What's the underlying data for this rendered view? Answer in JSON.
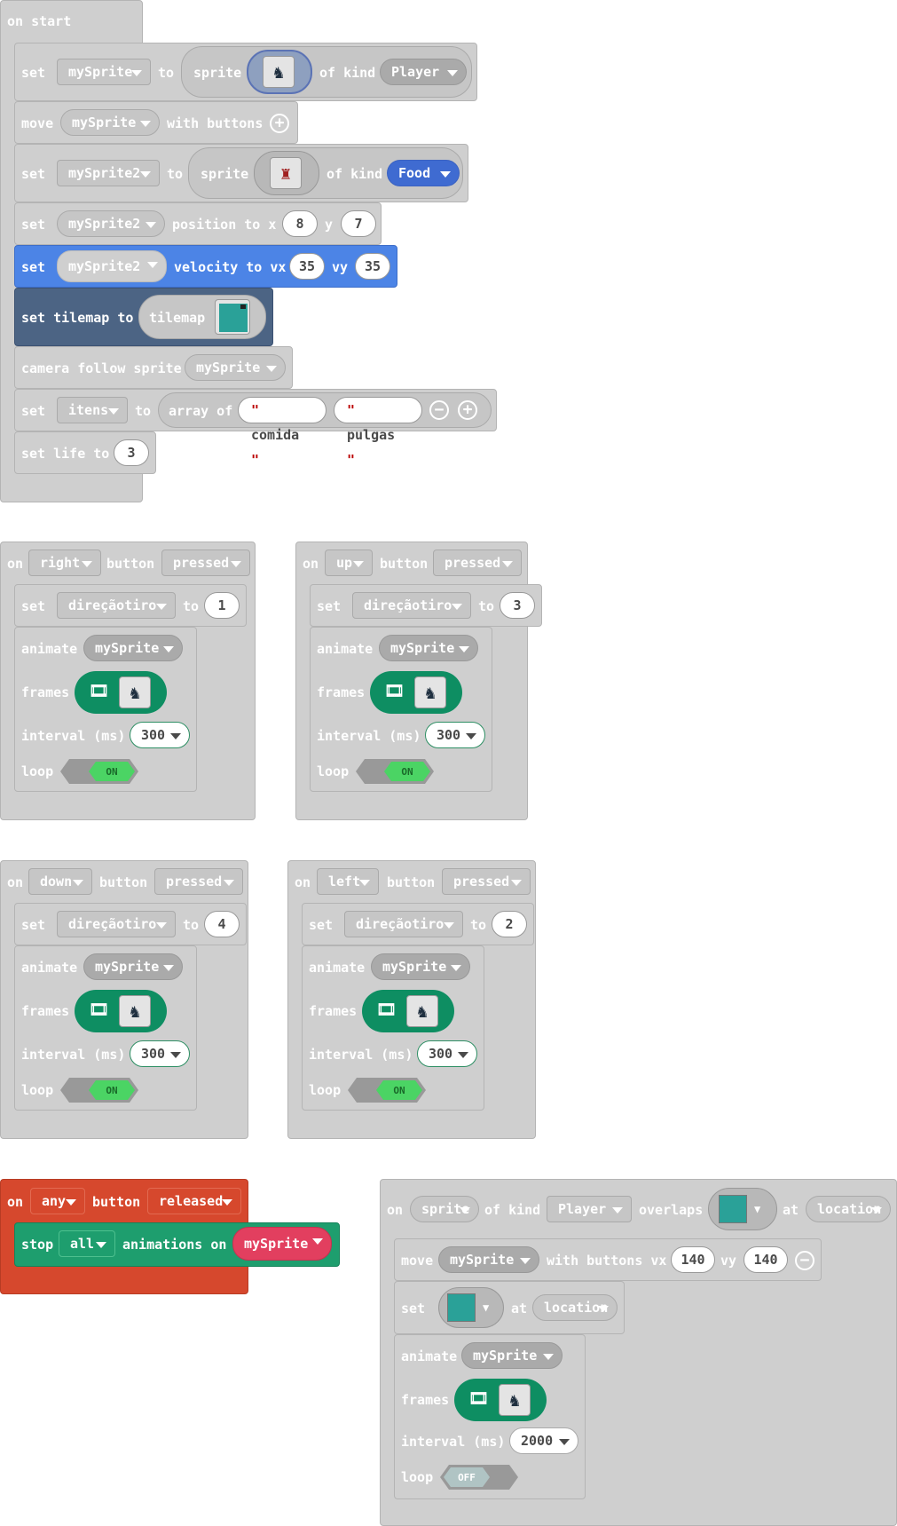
{
  "start": {
    "hat": "on start",
    "row1": {
      "set": "set",
      "var": "mySprite",
      "to": "to",
      "sprite": "sprite",
      "of_kind": "of kind",
      "kind": "Player"
    },
    "row2": {
      "move": "move",
      "var": "mySprite",
      "with_buttons": "with buttons"
    },
    "row3": {
      "set": "set",
      "var": "mySprite2",
      "to": "to",
      "sprite": "sprite",
      "of_kind": "of kind",
      "kind": "Food"
    },
    "row4": {
      "set": "set",
      "var": "mySprite2",
      "position_to_x": "position to x",
      "x": "8",
      "y_label": "y",
      "y": "7"
    },
    "row5": {
      "set": "set",
      "var": "mySprite2",
      "velocity_to_vx": "velocity to vx",
      "vx": "35",
      "vy_label": "vy",
      "vy": "35"
    },
    "row6": {
      "set_tilemap": "set tilemap to",
      "tilemap": "tilemap"
    },
    "row7": {
      "camera": "camera follow sprite",
      "var": "mySprite"
    },
    "row8": {
      "set": "set",
      "var": "itens",
      "to": "to",
      "array_of": "array of",
      "items": [
        "comida",
        "pulgas"
      ]
    },
    "row9": {
      "set_life": "set life to",
      "value": "3"
    }
  },
  "events": [
    {
      "on": "on",
      "button": "right",
      "button_label": "button",
      "state": "pressed",
      "set": "set",
      "var": "direçãotiro",
      "to": "to",
      "value": "1",
      "animate": "animate",
      "sprite": "mySprite",
      "frames": "frames",
      "interval_label": "interval (ms)",
      "interval": "300",
      "loop_label": "loop",
      "loop": "ON"
    },
    {
      "on": "on",
      "button": "up",
      "button_label": "button",
      "state": "pressed",
      "set": "set",
      "var": "direçãotiro",
      "to": "to",
      "value": "3",
      "animate": "animate",
      "sprite": "mySprite",
      "frames": "frames",
      "interval_label": "interval (ms)",
      "interval": "300",
      "loop_label": "loop",
      "loop": "ON"
    },
    {
      "on": "on",
      "button": "down",
      "button_label": "button",
      "state": "pressed",
      "set": "set",
      "var": "direçãotiro",
      "to": "to",
      "value": "4",
      "animate": "animate",
      "sprite": "mySprite",
      "frames": "frames",
      "interval_label": "interval (ms)",
      "interval": "300",
      "loop_label": "loop",
      "loop": "ON"
    },
    {
      "on": "on",
      "button": "left",
      "button_label": "button",
      "state": "pressed",
      "set": "set",
      "var": "direçãotiro",
      "to": "to",
      "value": "2",
      "animate": "animate",
      "sprite": "mySprite",
      "frames": "frames",
      "interval_label": "interval (ms)",
      "interval": "300",
      "loop_label": "loop",
      "loop": "ON"
    }
  ],
  "released": {
    "on": "on",
    "button": "any",
    "button_label": "button",
    "state": "released",
    "stop": "stop",
    "which": "all",
    "animations_on": "animations on",
    "sprite": "mySprite"
  },
  "overlap": {
    "on": "on",
    "sprite": "sprite",
    "of_kind": "of kind",
    "kind": "Player",
    "overlaps": "overlaps",
    "at": "at",
    "location": "location",
    "move": "move",
    "var": "mySprite",
    "with_buttons_vx": "with buttons vx",
    "vx": "140",
    "vy_label": "vy",
    "vy": "140",
    "set": "set",
    "at2": "at",
    "location2": "location",
    "animate": "animate",
    "anim_sprite": "mySprite",
    "frames": "frames",
    "interval_label": "interval (ms)",
    "interval": "2000",
    "loop_label": "loop",
    "loop": "OFF"
  },
  "colors": {
    "gray_block": "#cfcfcf",
    "blue_block": "#4c84e6",
    "tilemap_block": "#4c6484",
    "red_block": "#d6482d",
    "green_block": "#1e9e6e",
    "toggle_on": "#4bd464",
    "toggle_off": "#b0c4c4"
  }
}
